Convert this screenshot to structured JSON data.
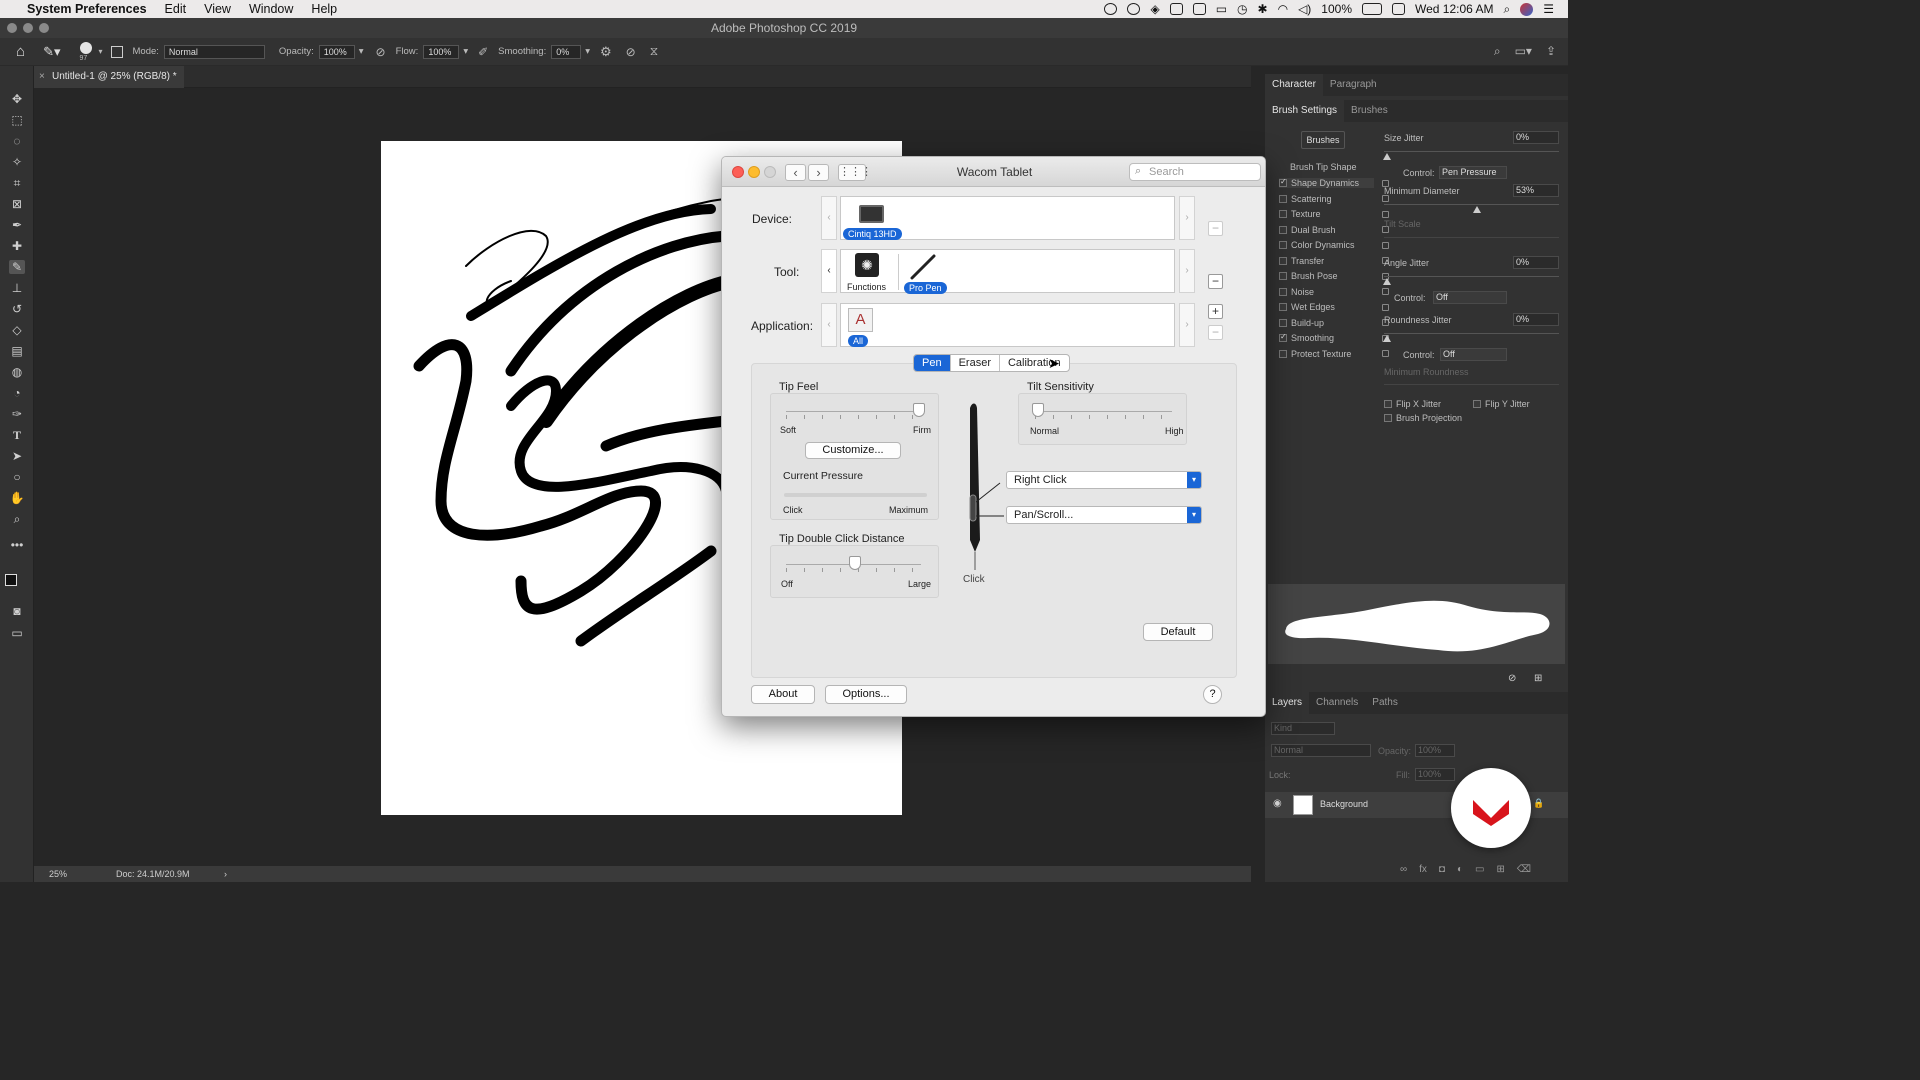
{
  "menubar": {
    "app": "System Preferences",
    "items": [
      "Edit",
      "View",
      "Window",
      "Help"
    ],
    "battery": "100%",
    "clock": "Wed 12:06 AM"
  },
  "photoshop": {
    "window_title": "Adobe Photoshop CC 2019",
    "options": {
      "brush_size": "97",
      "mode_label": "Mode:",
      "mode_value": "Normal",
      "opacity_label": "Opacity:",
      "opacity_value": "100%",
      "flow_label": "Flow:",
      "flow_value": "100%",
      "smoothing_label": "Smoothing:",
      "smoothing_value": "0%"
    },
    "doc_tab": "Untitled-1 @ 25% (RGB/8) *",
    "status": {
      "zoom": "25%",
      "doc": "Doc: 24.1M/20.9M"
    },
    "tools": [
      "move-icon",
      "marquee-icon",
      "lasso-icon",
      "magic-wand-icon",
      "crop-icon",
      "frame-icon",
      "eyedropper-icon",
      "healing-icon",
      "brush-icon",
      "stamp-icon",
      "history-brush-icon",
      "eraser-icon",
      "gradient-icon",
      "blur-icon",
      "dodge-icon",
      "pen-icon",
      "type-icon",
      "path-select-icon",
      "shape-icon",
      "hand-icon",
      "zoom-icon",
      "more-icon"
    ]
  },
  "panels": {
    "top_tabs": [
      "Character",
      "Paragraph"
    ],
    "brush_tabs": [
      "Brush Settings",
      "Brushes"
    ],
    "brushes_button": "Brushes",
    "brush_tip_shape": "Brush Tip Shape",
    "brush_options": [
      {
        "label": "Shape Dynamics",
        "checked": true
      },
      {
        "label": "Scattering",
        "checked": false
      },
      {
        "label": "Texture",
        "checked": false
      },
      {
        "label": "Dual Brush",
        "checked": false
      },
      {
        "label": "Color Dynamics",
        "checked": false
      },
      {
        "label": "Transfer",
        "checked": false
      },
      {
        "label": "Brush Pose",
        "checked": false
      },
      {
        "label": "Noise",
        "checked": false
      },
      {
        "label": "Wet Edges",
        "checked": false
      },
      {
        "label": "Build-up",
        "checked": false
      },
      {
        "label": "Smoothing",
        "checked": true
      },
      {
        "label": "Protect Texture",
        "checked": false
      }
    ],
    "settings": {
      "size_jitter": "Size Jitter",
      "size_jitter_value": "0%",
      "control": "Control:",
      "control_pen_pressure": "Pen Pressure",
      "min_diameter": "Minimum Diameter",
      "min_diameter_value": "53%",
      "tilt_scale": "Tilt Scale",
      "angle_jitter": "Angle Jitter",
      "angle_jitter_value": "0%",
      "control_off": "Off",
      "roundness_jitter": "Roundness Jitter",
      "roundness_jitter_value": "0%",
      "min_roundness": "Minimum Roundness",
      "flip_x": "Flip X Jitter",
      "flip_y": "Flip Y Jitter",
      "brush_projection": "Brush Projection"
    },
    "layers_tabs": [
      "Layers",
      "Channels",
      "Paths"
    ],
    "layers": {
      "kind": "Kind",
      "blend": "Normal",
      "opacity_label": "Opacity:",
      "opacity": "100%",
      "lock_label": "Lock:",
      "fill_label": "Fill:",
      "fill": "100%",
      "layer_name": "Background"
    }
  },
  "wacom": {
    "title": "Wacom Tablet",
    "search_placeholder": "Search",
    "device_label": "Device:",
    "device_name": "Cintiq 13HD",
    "tool_label": "Tool:",
    "tool_functions": "Functions",
    "tool_pen": "Pro Pen",
    "application_label": "Application:",
    "app_all": "All",
    "tabs": [
      "Pen",
      "Eraser",
      "Calibration"
    ],
    "tip_feel": "Tip Feel",
    "soft": "Soft",
    "firm": "Firm",
    "customize": "Customize...",
    "current_pressure": "Current Pressure",
    "click": "Click",
    "maximum": "Maximum",
    "tip_double_click": "Tip Double Click Distance",
    "off": "Off",
    "large": "Large",
    "tilt_sensitivity": "Tilt Sensitivity",
    "normal": "Normal",
    "high": "High",
    "upper_button": "Right Click",
    "lower_button": "Pan/Scroll...",
    "pen_tip_label": "Click",
    "default": "Default",
    "about": "About",
    "options": "Options...",
    "help": "?"
  }
}
